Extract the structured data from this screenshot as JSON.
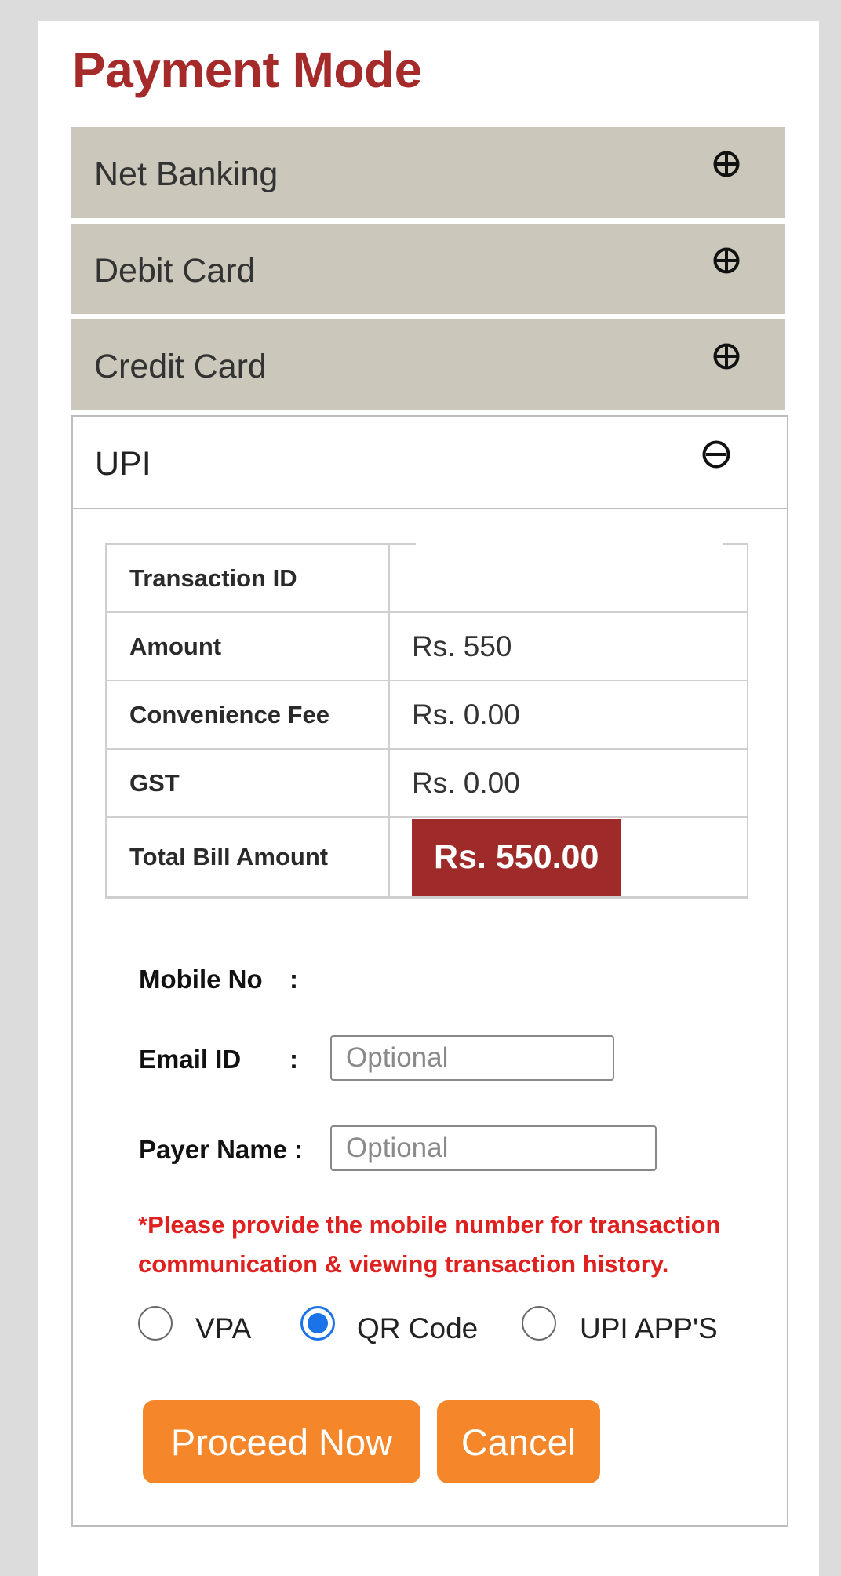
{
  "title": "Payment Mode",
  "accordion": {
    "net_banking": "Net Banking",
    "debit_card": "Debit Card",
    "credit_card": "Credit Card",
    "upi": "UPI"
  },
  "summary": {
    "rows": [
      {
        "label": "Transaction ID",
        "value": ""
      },
      {
        "label": "Amount",
        "value": "Rs. 550"
      },
      {
        "label": "Convenience Fee",
        "value": "Rs. 0.00"
      },
      {
        "label": "GST",
        "value": "Rs. 0.00"
      }
    ],
    "total": {
      "label": "Total Bill Amount",
      "value": "Rs. 550.00"
    }
  },
  "form": {
    "mobile_label": "Mobile No",
    "email_label": "Email ID",
    "payer_label": "Payer Name :",
    "colon": ":",
    "email_placeholder": "Optional",
    "payer_placeholder": "Optional",
    "note": "*Please provide the mobile number for transaction communication & viewing transaction history."
  },
  "upi_options": {
    "vpa": "VPA",
    "qr": "QR Code",
    "apps": "UPI APP'S",
    "selected": "QR Code"
  },
  "buttons": {
    "proceed": "Proceed Now",
    "cancel": "Cancel"
  },
  "colors": {
    "title": "#a52a2a",
    "accordion_bg": "#cbc8bb",
    "total_badge": "#9f2a2a",
    "note": "#e01f1f",
    "button": "#f5862a",
    "radio_selected": "#1a73e8"
  },
  "icons": {
    "collapsed": "plus-circle-icon",
    "expanded": "minus-circle-icon"
  }
}
